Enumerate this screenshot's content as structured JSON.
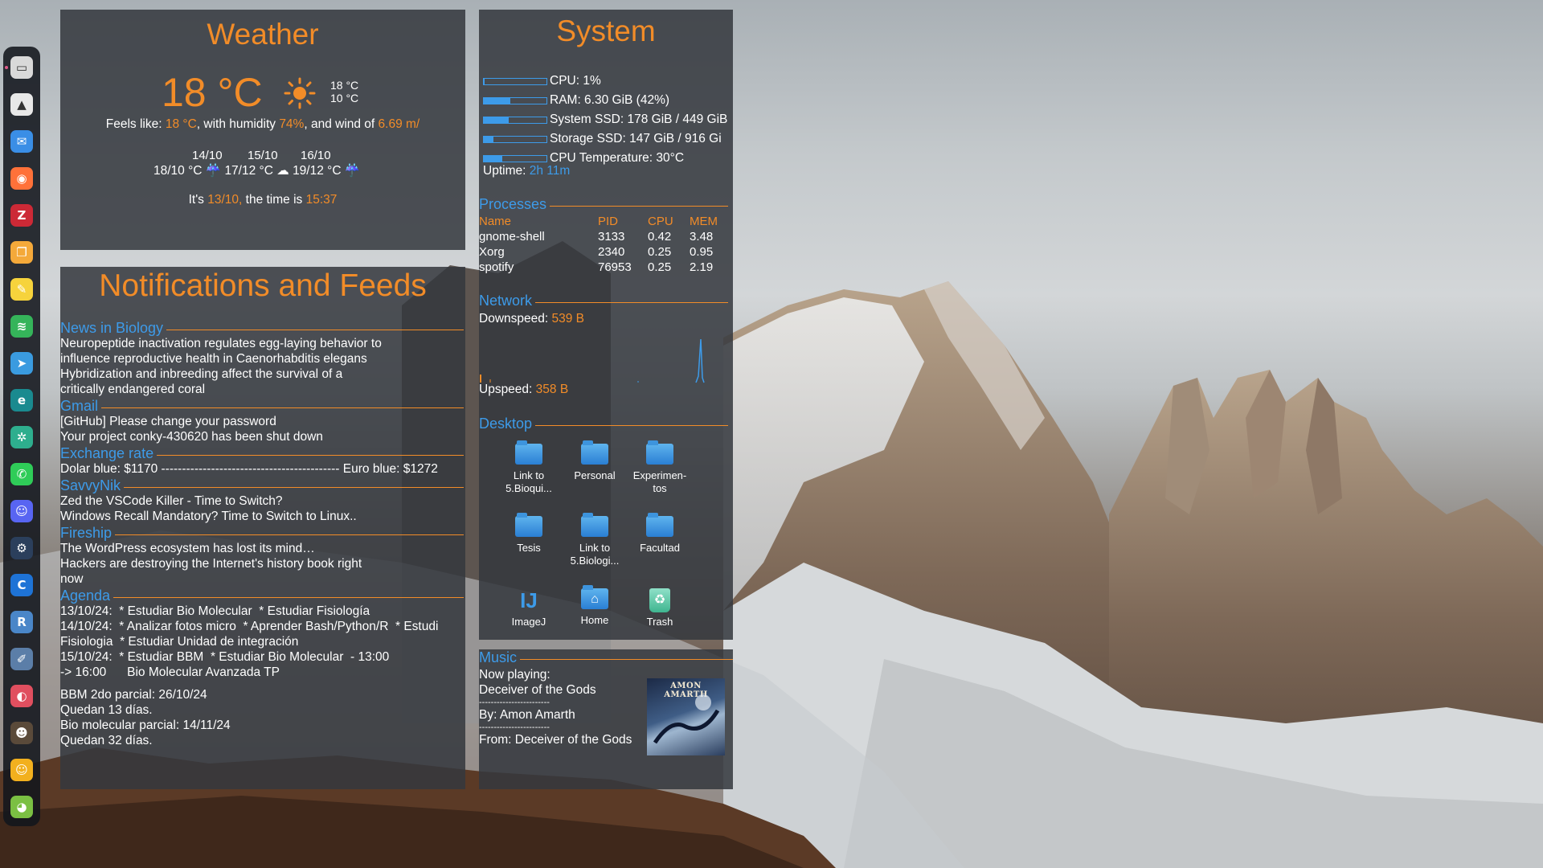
{
  "weather": {
    "title": "Weather",
    "temp": "18 °C",
    "icon": "sun-icon",
    "high": "18 °C",
    "low": "10 °C",
    "feels_prefix": "Feels like: ",
    "feels_value": "18 °C",
    "feels_mid": ", with humidity ",
    "humidity": "74%",
    "wind_mid": ", and wind of ",
    "wind": "6.69 m/",
    "forecast": [
      {
        "date": "14/10",
        "temps": "18/10 °C",
        "icon": "rain-icon"
      },
      {
        "date": "15/10",
        "temps": "17/12 °C",
        "icon": "cloud-icon"
      },
      {
        "date": "16/10",
        "temps": "19/12 °C",
        "icon": "rain-icon"
      }
    ],
    "its": "It's ",
    "date": "13/10,",
    "time_mid": " the time is ",
    "time": "15:37"
  },
  "notifications": {
    "title": "Notifications and Feeds",
    "sections": [
      {
        "head": "News in Biology",
        "lines": [
          "Neuropeptide inactivation regulates egg-laying behavior to",
          "influence reproductive health in Caenorhabditis elegans",
          "Hybridization and inbreeding affect the survival of a",
          "critically endangered coral"
        ]
      },
      {
        "head": "Gmail",
        "lines": [
          "[GitHub] Please change your password",
          "Your project conky-430620 has been shut down"
        ]
      },
      {
        "head": "Exchange rate",
        "lines": [
          "Dolar blue: $1170 ------------------------------------------- Euro blue: $1272"
        ]
      },
      {
        "head": "SavvyNik",
        "lines": [
          "Zed the VSCode Killer - Time to Switch?",
          "Windows Recall Mandatory? Time to Switch to Linux.."
        ]
      },
      {
        "head": "Fireship",
        "lines": [
          "The WordPress ecosystem has lost its mind…",
          "Hackers are destroying the Internet's history book right",
          "now"
        ]
      },
      {
        "head": "Agenda",
        "lines": [
          "13/10/24:  * Estudiar Bio Molecular  * Estudiar Fisiología",
          "14/10/24:  * Analizar fotos micro  * Aprender Bash/Python/R  * Estudi",
          "Fisiologia  * Estudiar Unidad de integración",
          "15/10/24:  * Estudiar BBM  * Estudiar Bio Molecular  - 13:00",
          "-> 16:00      Bio Molecular Avanzada TP",
          "",
          "BBM 2do parcial: 26/10/24",
          "Quedan 13 días.",
          "Bio molecular parcial: 14/11/24",
          "Quedan 32 días."
        ]
      }
    ]
  },
  "system": {
    "title": "System",
    "rows": [
      {
        "label": "CPU: 1%",
        "fraction": 0.01
      },
      {
        "label": "RAM: 6.30 GiB (42%)",
        "fraction": 0.42
      },
      {
        "label": "System SSD: 178 GiB / 449 GiB",
        "fraction": 0.4
      },
      {
        "label": "Storage SSD: 147 GiB / 916 Gi",
        "fraction": 0.16
      },
      {
        "label": "CPU Temperature: 30°C",
        "fraction": 0.3
      }
    ],
    "uptime_label": "Uptime: ",
    "uptime_value": "2h 11m",
    "processes_head": "Processes",
    "proc_cols": [
      "Name",
      "PID",
      "CPU",
      "MEM"
    ],
    "processes": [
      {
        "name": "gnome-shell",
        "pid": "3133",
        "cpu": "0.42",
        "mem": "3.48"
      },
      {
        "name": "Xorg",
        "pid": "2340",
        "cpu": "0.25",
        "mem": "0.95"
      },
      {
        "name": "spotify",
        "pid": "76953",
        "cpu": "0.25",
        "mem": "2.19"
      }
    ],
    "network_head": "Network",
    "down_label": "Downspeed: ",
    "down_value": "539 B",
    "up_label": "Upspeed: ",
    "up_value": "358 B",
    "desktop_head": "Desktop",
    "desktop_items": [
      {
        "label": "Link to\n5.Bioqui...",
        "icon": "folder-link-icon"
      },
      {
        "label": "Personal",
        "icon": "folder-icon"
      },
      {
        "label": "Experimen-\ntos",
        "icon": "folder-link-icon"
      },
      {
        "label": "Tesis",
        "icon": "folder-icon"
      },
      {
        "label": "Link to\n5.Biologi...",
        "icon": "folder-link-icon"
      },
      {
        "label": "Facultad",
        "icon": "folder-link-icon"
      },
      {
        "label": "ImageJ",
        "icon": "imagej-icon"
      },
      {
        "label": "Home",
        "icon": "home-folder-icon"
      },
      {
        "label": "Trash",
        "icon": "trash-icon"
      }
    ]
  },
  "music": {
    "head": "Music",
    "now_playing": "Now playing:",
    "track": "Deceiver of the Gods",
    "sep": "------------------------",
    "by": "By: Amon Amarth",
    "from": "From: Deceiver of the Gods",
    "cover_text": "AMON AMARTH"
  },
  "dock": [
    {
      "icon": "files-icon",
      "color": "#d9d9d9"
    },
    {
      "icon": "google-drive-icon",
      "color": "#e8e8e8"
    },
    {
      "icon": "email-client-icon",
      "color": "#3a8ee6"
    },
    {
      "icon": "firefox-icon",
      "color": "#ff7139"
    },
    {
      "icon": "zotero-icon",
      "color": "#cc2936"
    },
    {
      "icon": "document-viewer-icon",
      "color": "#f4a93a"
    },
    {
      "icon": "sticky-notes-icon",
      "color": "#f6d33c"
    },
    {
      "icon": "spotify-icon",
      "color": "#35b45a"
    },
    {
      "icon": "telegram-desktop-icon",
      "color": "#3a9be0"
    },
    {
      "icon": "edge-browser-icon",
      "color": "#1a8a8f"
    },
    {
      "icon": "chatgpt-icon",
      "color": "#2eae8e"
    },
    {
      "icon": "whatsapp-icon",
      "color": "#2fcc58"
    },
    {
      "icon": "discord-icon",
      "color": "#5865f2"
    },
    {
      "icon": "steam-icon",
      "color": "#2b3f5c"
    },
    {
      "icon": "ccleaner-icon",
      "color": "#1e73d6"
    },
    {
      "icon": "rstudio-icon",
      "color": "#4a86c8"
    },
    {
      "icon": "text-editor-icon",
      "color": "#5b7ea8"
    },
    {
      "icon": "color-picker-icon",
      "color": "#e04f5f"
    },
    {
      "icon": "cat-app-icon",
      "color": "#5a4a3a"
    },
    {
      "icon": "emoji-picker-icon",
      "color": "#f2b01e"
    },
    {
      "icon": "android-app-icon",
      "color": "#7bc043"
    }
  ]
}
